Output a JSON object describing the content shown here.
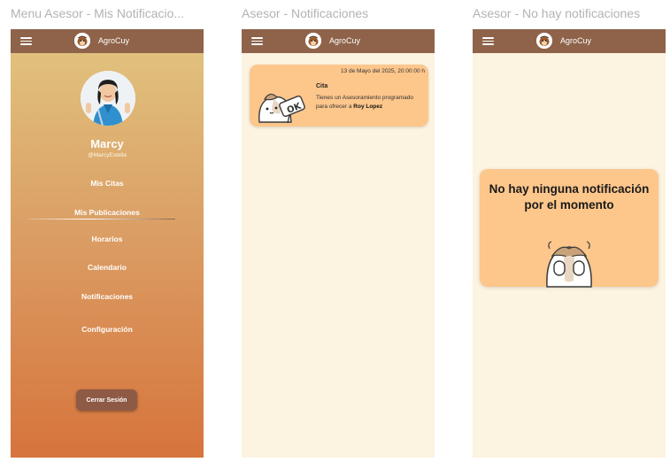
{
  "frames": [
    {
      "title": "Menu Asesor - Mis Notificacio..."
    },
    {
      "title": "Asesor - Notificaciones"
    },
    {
      "title": "Asesor - No hay notificaciones"
    }
  ],
  "appbar": {
    "app_name": "AgroCuy",
    "menu_icon": "hamburger-icon",
    "logo_icon": "guinea-pig-logo-icon"
  },
  "profile": {
    "name": "Marcy",
    "handle": "@MarcyEstella"
  },
  "menu": {
    "items": [
      {
        "label": "Mis Citas"
      },
      {
        "label": "Mis Publicaciones"
      },
      {
        "label": "Horarios"
      },
      {
        "label": "Calendario"
      },
      {
        "label": "Notificaciones"
      },
      {
        "label": "Configuración"
      }
    ],
    "logout_label": "Cerrar Sesión"
  },
  "notification": {
    "date": "13 de Mayo del 2025, 20:00:00 h",
    "title": "Cita",
    "body_prefix": "Tienes un Asesoramiento programado para ofrecer a ",
    "person": "Roy Lopez",
    "sign_text": "OK"
  },
  "empty_state": {
    "message": "No hay ninguna notificación por el momento"
  },
  "colors": {
    "appbar": "#8e634a",
    "card": "#fdc68b",
    "background": "#fdf3e1",
    "logout_button": "#8e5a46"
  }
}
